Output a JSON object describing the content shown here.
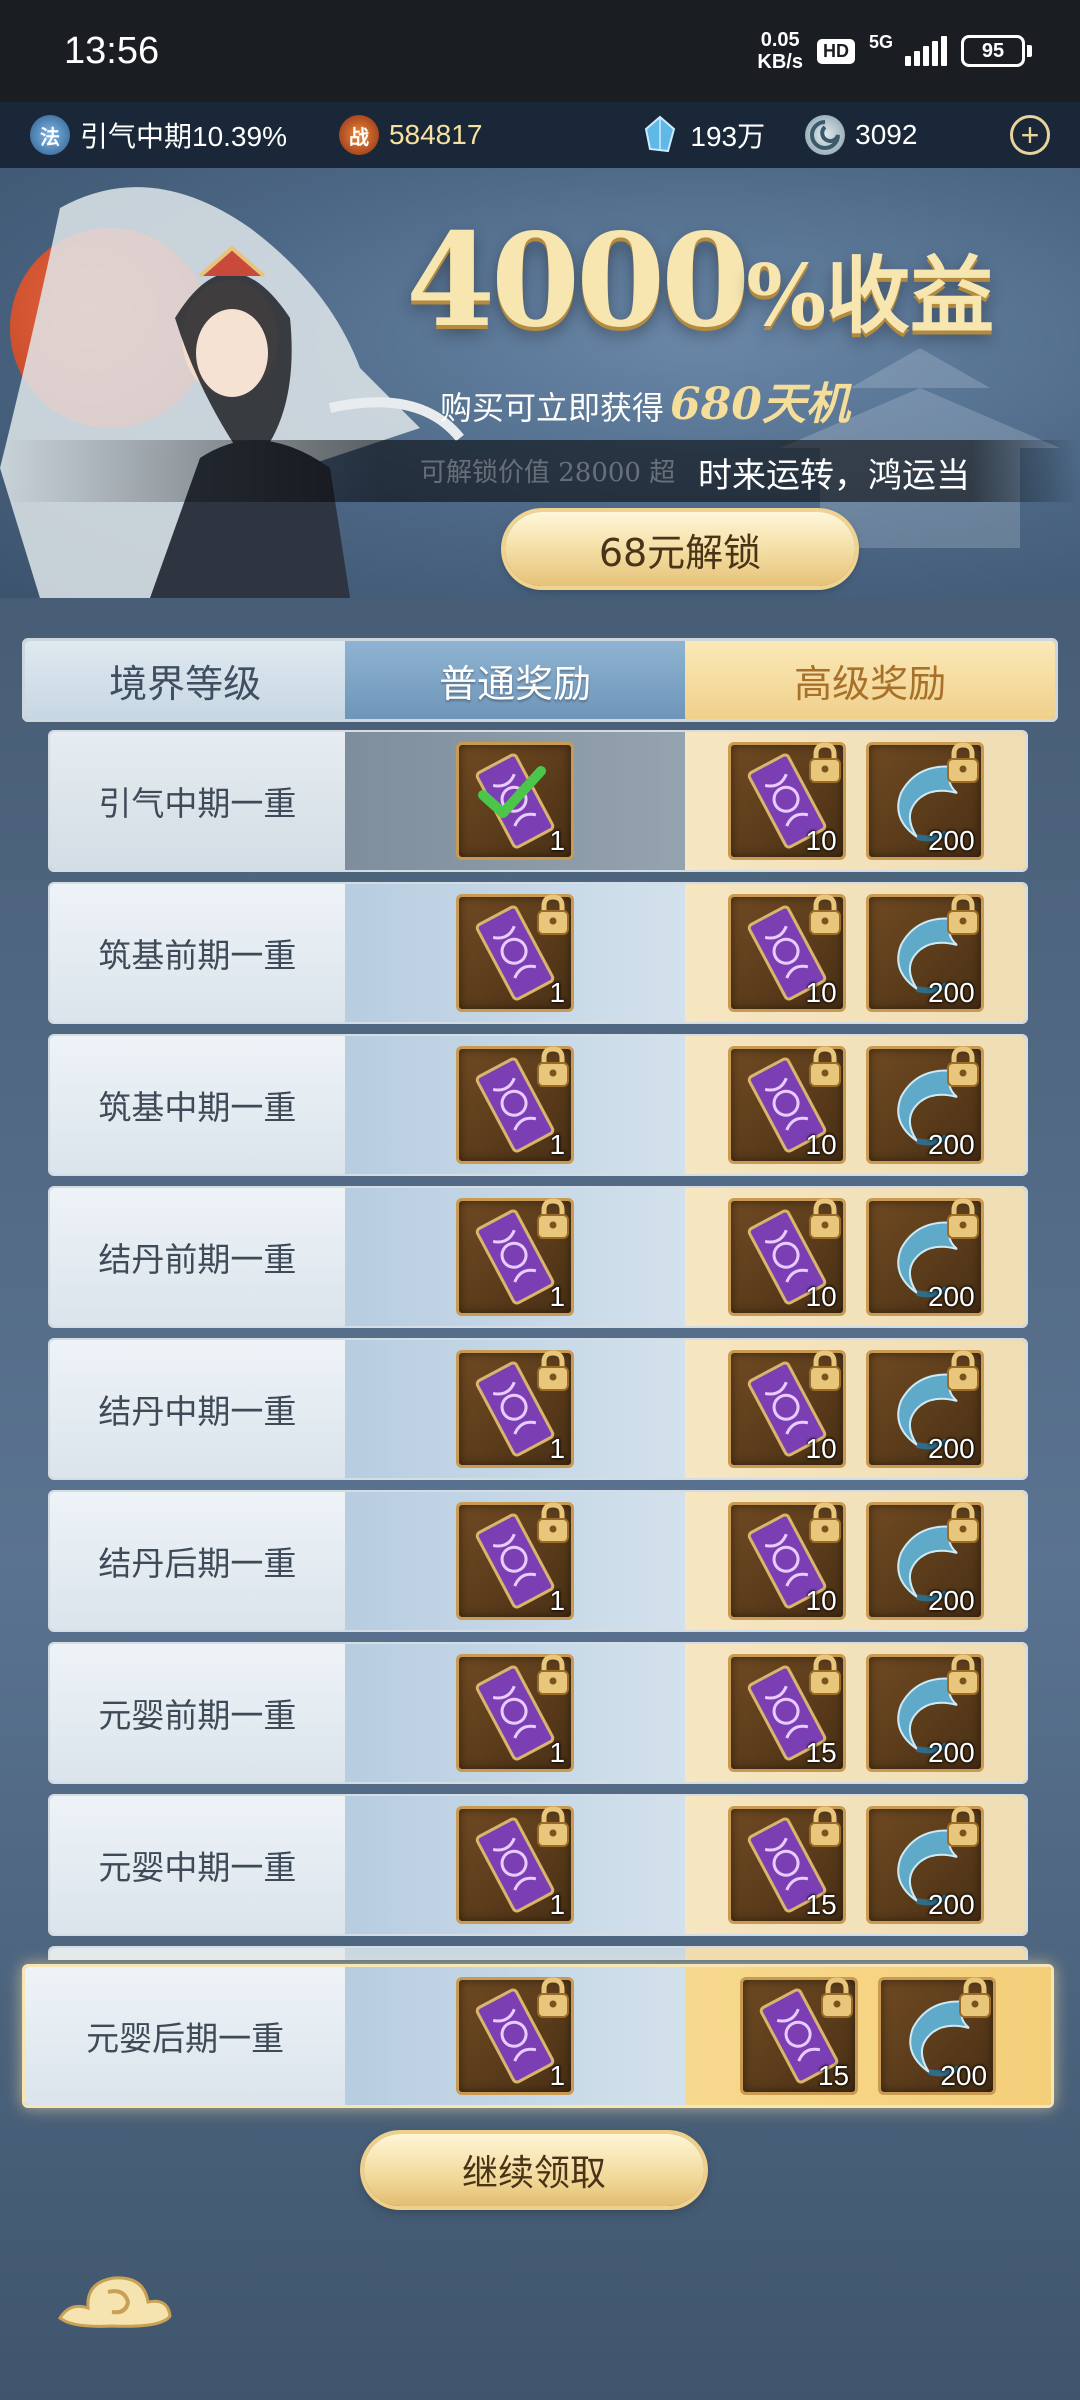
{
  "status_bar": {
    "time": "13:56",
    "net_speed_value": "0.05",
    "net_speed_unit": "KB/s",
    "hd": "HD",
    "network": "5G",
    "battery": "95"
  },
  "resources": {
    "realm": "引气中期10.39%",
    "realm_icon_char": "法",
    "power_icon_char": "战",
    "power": "584817",
    "crystals": "193万",
    "coins": "3092",
    "plus": "+"
  },
  "banner": {
    "headline_number": "4000",
    "headline_suffix": "%收益",
    "subline_prefix": "购买可立即获得",
    "subline_amount": "680天机",
    "value_text_ghost": "可解锁价值 28000 超",
    "notice": "时来运转，鸿运当",
    "unlock_button": "68元解锁"
  },
  "table": {
    "headers": [
      "境界等级",
      "普通奖励",
      "高级奖励"
    ],
    "rows": [
      {
        "realm": "引气中期一重",
        "normal_qty": "1",
        "premium_qty_1": "10",
        "premium_qty_2": "200",
        "claimed": true
      },
      {
        "realm": "筑基前期一重",
        "normal_qty": "1",
        "premium_qty_1": "10",
        "premium_qty_2": "200",
        "claimed": false
      },
      {
        "realm": "筑基中期一重",
        "normal_qty": "1",
        "premium_qty_1": "10",
        "premium_qty_2": "200",
        "claimed": false
      },
      {
        "realm": "结丹前期一重",
        "normal_qty": "1",
        "premium_qty_1": "10",
        "premium_qty_2": "200",
        "claimed": false
      },
      {
        "realm": "结丹中期一重",
        "normal_qty": "1",
        "premium_qty_1": "10",
        "premium_qty_2": "200",
        "claimed": false
      },
      {
        "realm": "结丹后期一重",
        "normal_qty": "1",
        "premium_qty_1": "10",
        "premium_qty_2": "200",
        "claimed": false
      },
      {
        "realm": "元婴前期一重",
        "normal_qty": "1",
        "premium_qty_1": "15",
        "premium_qty_2": "200",
        "claimed": false
      },
      {
        "realm": "元婴中期一重",
        "normal_qty": "1",
        "premium_qty_1": "15",
        "premium_qty_2": "200",
        "claimed": false
      }
    ],
    "highlight_row": {
      "realm": "元婴后期一重",
      "normal_qty": "1",
      "premium_qty_1": "15",
      "premium_qty_2": "200"
    }
  },
  "continue_button": "继续领取",
  "icons": {
    "talisman": "talisman-icon",
    "claw": "claw-icon",
    "lock": "lock-icon",
    "check": "check-icon",
    "cloud": "cloud-icon"
  },
  "colors": {
    "accent_gold": "#f3dca0",
    "premium_bg": "#efddb4",
    "normal_bg": "#b7cde0",
    "claimed_check": "#4cc64a"
  }
}
